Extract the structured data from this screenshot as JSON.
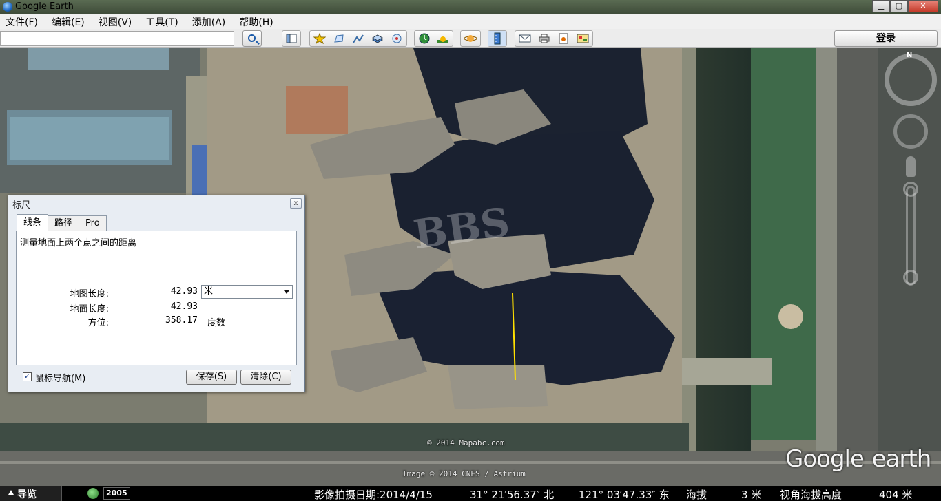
{
  "window": {
    "title": "Google Earth",
    "minimize": "▁",
    "maximize": "▢",
    "close": "✕"
  },
  "menu": [
    "文件(F)",
    "编辑(E)",
    "视图(V)",
    "工具(T)",
    "添加(A)",
    "帮助(H)"
  ],
  "toolbar": {
    "search_value": "",
    "login_label": "登录",
    "icons": [
      "sidebar-icon",
      "placemark-icon",
      "polygon-icon",
      "path-icon",
      "overlay-icon",
      "tour-icon",
      "historical-imagery-icon",
      "sunlight-icon",
      "planets-icon",
      "ruler-icon",
      "email-icon",
      "print-icon",
      "save-image-icon",
      "maps-icon"
    ]
  },
  "map": {
    "watermark": "BBS",
    "copyright_1": "© 2014 Mapabc.com",
    "copyright_2": "Image © 2014 CNES / Astrium",
    "logo_google": "Google",
    "logo_earth": "earth",
    "compass_n": "N"
  },
  "ruler": {
    "title": "标尺",
    "close": "x",
    "tabs": [
      "线条",
      "路径",
      "Pro"
    ],
    "active_tab": 0,
    "description": "测量地面上两个点之间的距离",
    "map_length_label": "地图长度:",
    "map_length_value": "42.93",
    "unit": "米",
    "ground_length_label": "地面长度:",
    "ground_length_value": "42.93",
    "heading_label": "方位:",
    "heading_value": "358.17",
    "heading_unit": "度数",
    "mouse_nav_label": "鼠标导航(M)",
    "mouse_nav_checked": true,
    "save_label": "保存(S)",
    "clear_label": "清除(C)",
    "measure_line_color": "#ffe000"
  },
  "status": {
    "nav_label": "导览",
    "year": "2005",
    "imagery_date": "影像拍摄日期:2014/4/15",
    "lat": "31° 21′56.37″ 北",
    "lon": "121° 03′47.33″ 东",
    "elev_label": "海拔",
    "elev_value": "3 米",
    "eye_alt_label": "视角海拔高度",
    "eye_alt_value": "404 米"
  }
}
